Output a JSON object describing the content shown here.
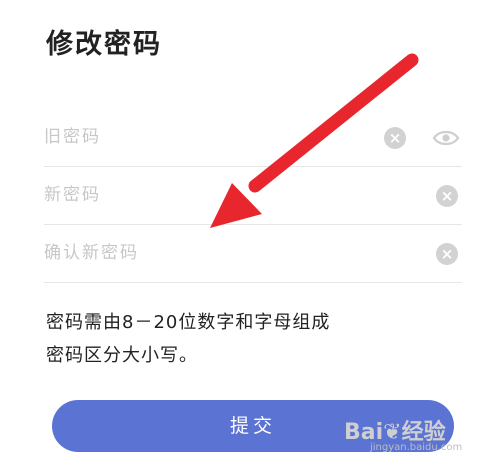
{
  "page": {
    "title": "修改密码"
  },
  "fields": {
    "old_password": {
      "placeholder": "旧密码",
      "value": ""
    },
    "new_password": {
      "placeholder": "新密码",
      "value": ""
    },
    "confirm_password": {
      "placeholder": "确认新密码",
      "value": ""
    }
  },
  "icons": {
    "clear": "clear-circle-icon",
    "visibility": "eye-icon",
    "annotation": "red-arrow"
  },
  "hint": {
    "line1": "密码需由8－20位数字和字母组成",
    "line2": "密码区分大小写。"
  },
  "submit": {
    "label": "提交"
  },
  "watermark": {
    "brand_left": "Bai",
    "brand_right": "经验",
    "sub": "jingyan.baidu.com"
  },
  "colors": {
    "accent": "#5b73d3",
    "arrow": "#e8262d",
    "placeholder": "#c7c7c7",
    "clear_icon": "#d2d2d2"
  }
}
